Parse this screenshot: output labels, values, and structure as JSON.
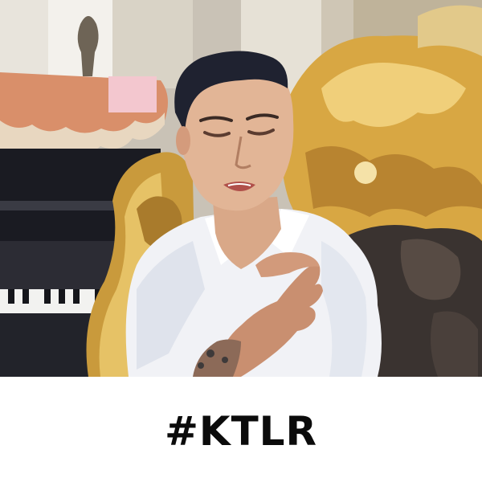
{
  "caption": {
    "text": "#KTLR"
  },
  "colors": {
    "caption_text": "#0b0b0b",
    "caption_background": "#ffffff",
    "shirt": "#f1f2f6",
    "gold_ornament": "#d8a743",
    "hair": "#1f2230"
  }
}
